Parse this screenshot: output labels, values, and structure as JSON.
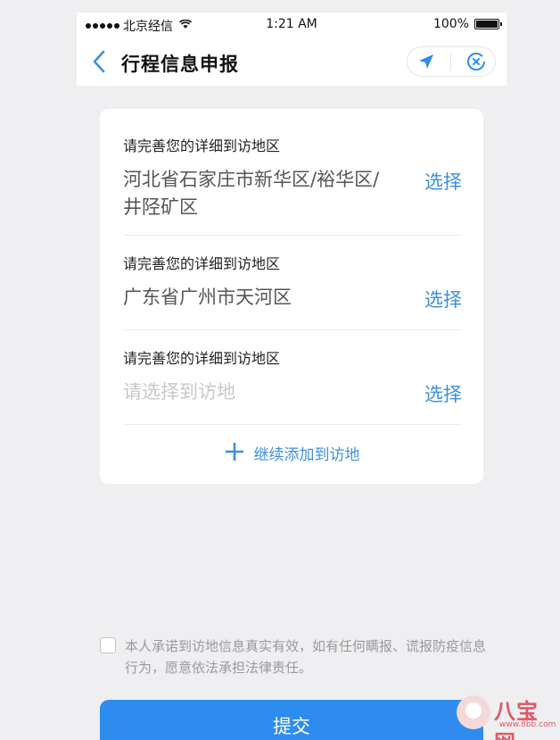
{
  "status_bar": {
    "carrier": "北京经信",
    "time": "1:21 AM",
    "battery_text": "100%"
  },
  "nav": {
    "title": "行程信息申报"
  },
  "rows": [
    {
      "label": "请完善您的详细到访地区",
      "value": "河北省石家庄市新华区/裕华区/井陉矿区",
      "action": "选择"
    },
    {
      "label": "请完善您的详细到访地区",
      "value": "广东省广州市天河区",
      "action": "选择"
    },
    {
      "label": "请完善您的详细到访地区",
      "placeholder": "请选择到访地",
      "action": "选择"
    }
  ],
  "add_more_label": "继续添加到访地",
  "pledge_text": "本人承诺到访地信息真实有效，如有任何瞒报、谎报防疫信息行为，愿意依法承担法律责任。",
  "submit_label": "提交",
  "watermark": {
    "brand": "八宝网",
    "url": "www.8bb.com"
  },
  "colors": {
    "accent": "#3d8fd9",
    "button": "#2d8cee",
    "background": "#efeff1"
  }
}
